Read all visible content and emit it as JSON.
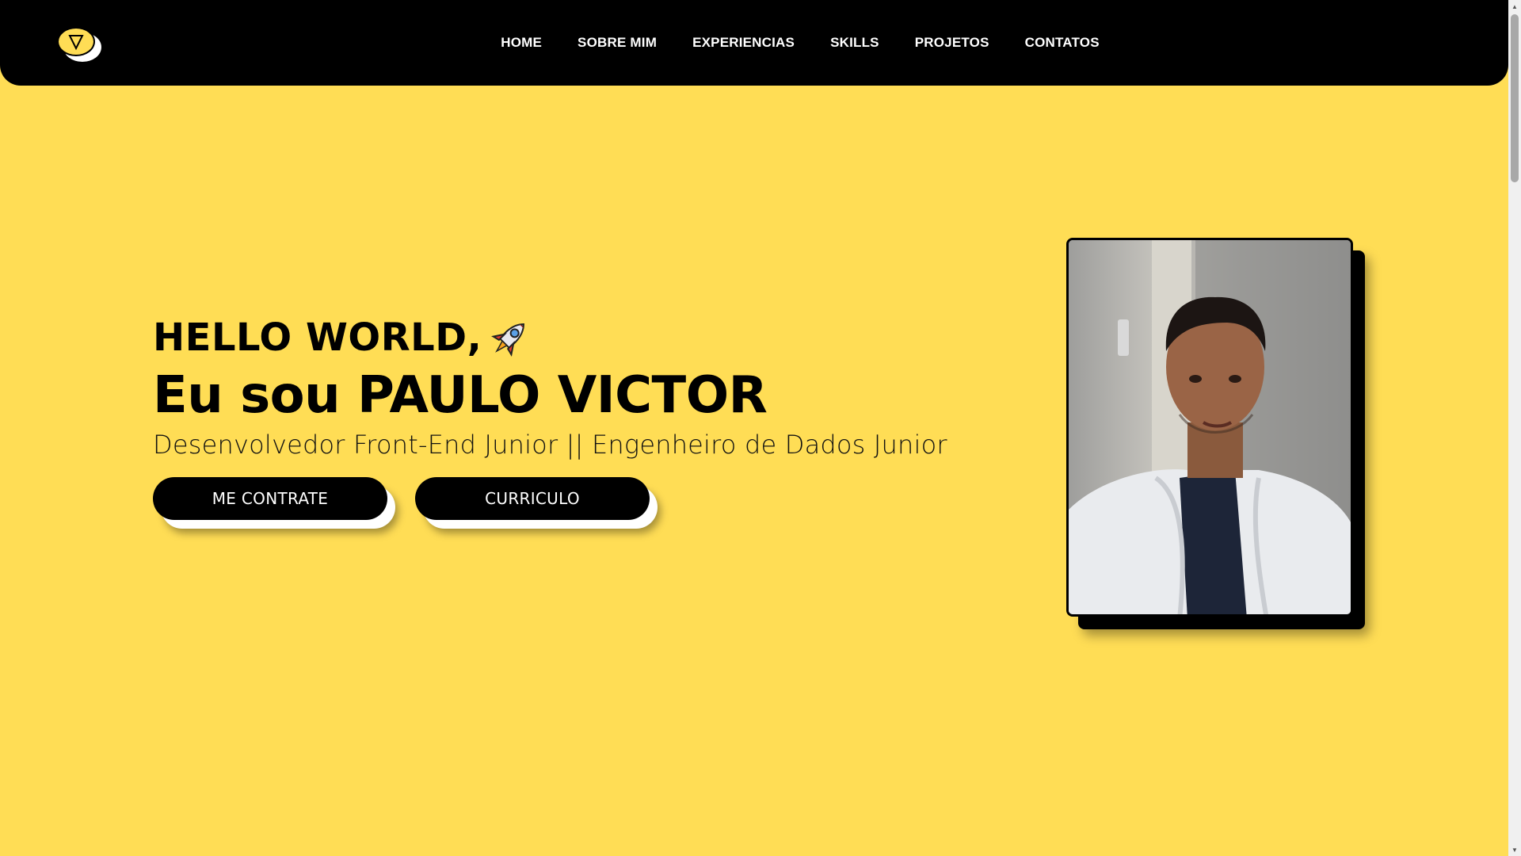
{
  "header": {
    "logo_icon": "triangle-down-logo",
    "nav": [
      {
        "label": "HOME"
      },
      {
        "label": "SOBRE MIM"
      },
      {
        "label": "EXPERIENCIAS"
      },
      {
        "label": "SKILLS"
      },
      {
        "label": "PROJETOS"
      },
      {
        "label": "CONTATOS"
      }
    ]
  },
  "hero": {
    "greeting": "HELLO WORLD,",
    "greeting_icon": "rocket-icon",
    "name": "Eu sou PAULO VICTOR",
    "role": "Desenvolvedor Front-End Junior || Engenheiro de Dados Junior",
    "buttons": {
      "hire": "ME CONTRATE",
      "resume": "CURRICULO"
    }
  },
  "colors": {
    "background": "#FFDD55",
    "header": "#000000",
    "button": "#000000",
    "button_text": "#FFFFFF"
  }
}
